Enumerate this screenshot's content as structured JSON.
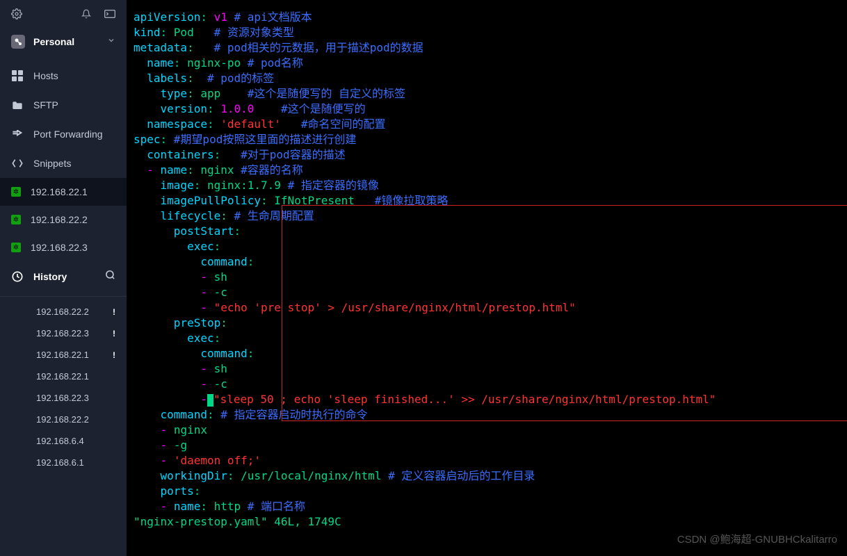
{
  "account": {
    "label": "Personal"
  },
  "nav": {
    "hosts": "Hosts",
    "sftp": "SFTP",
    "port_forwarding": "Port Forwarding",
    "snippets": "Snippets"
  },
  "servers": [
    {
      "ip": "192.168.22.1",
      "active": true
    },
    {
      "ip": "192.168.22.2",
      "active": false
    },
    {
      "ip": "192.168.22.3",
      "active": false
    }
  ],
  "history_label": "History",
  "history": [
    {
      "ip": "192.168.22.2",
      "alert": true
    },
    {
      "ip": "192.168.22.3",
      "alert": true
    },
    {
      "ip": "192.168.22.1",
      "alert": true
    },
    {
      "ip": "192.168.22.1",
      "alert": false
    },
    {
      "ip": "192.168.22.3",
      "alert": false
    },
    {
      "ip": "192.168.22.2",
      "alert": false
    },
    {
      "ip": "192.168.6.4",
      "alert": false
    },
    {
      "ip": "192.168.6.1",
      "alert": false
    }
  ],
  "code": {
    "l1_k": "apiVersion",
    "l1_v": "v1",
    "l1_c": "# api文档版本",
    "l2_k": "kind",
    "l2_v": "Pod",
    "l2_c": "# 资源对象类型",
    "l3_k": "metadata",
    "l3_c": "# pod相关的元数据，用于描述pod的数据",
    "l4_k": "name",
    "l4_v": "nginx-po",
    "l4_c": "# pod名称",
    "l5_k": "labels",
    "l5_c": "# pod的标签",
    "l6_k": "type",
    "l6_v": "app",
    "l6_c": "#这个是随便写的 自定义的标签",
    "l7_k": "version",
    "l7_v": "1.0.0",
    "l7_c": "#这个是随便写的",
    "l8_k": "namespace",
    "l8_v": "'default'",
    "l8_c": "#命名空间的配置",
    "l9_k": "spec",
    "l9_c": "#期望pod按照这里面的描述进行创建",
    "l10_k": "containers",
    "l10_c": "#对于pod容器的描述",
    "l11_d": "-",
    "l11_k": "name",
    "l11_v": "nginx",
    "l11_c": "#容器的名称",
    "l12_k": "image",
    "l12_v": "nginx:1.7.9",
    "l12_c": "# 指定容器的镜像",
    "l13_k": "imagePullPolicy",
    "l13_v": "IfNotPresent",
    "l13_c": "#镜像拉取策略",
    "l14_k": "lifecycle",
    "l14_c": "# 生命周期配置",
    "l15_k": "postStart",
    "l16_k": "exec",
    "l17_k": "command",
    "l18_d": "-",
    "l18_v": "sh",
    "l19_d": "-",
    "l19_v": "-c",
    "l20_d": "-",
    "l20_v": "\"echo 'pre stop' > /usr/share/nginx/html/prestop.html\"",
    "l21_k": "preStop",
    "l22_k": "exec",
    "l23_k": "command",
    "l24_d": "-",
    "l24_v": "sh",
    "l25_d": "-",
    "l25_v": "-c",
    "l26_d": "-",
    "l26_v": "\"sleep 50 ; echo 'sleep finished...' >> /usr/share/nginx/html/prestop.html\"",
    "l27_k": "command",
    "l27_c": "# 指定容器启动时执行的命令",
    "l28_d": "-",
    "l28_v": "nginx",
    "l29_d": "-",
    "l29_v": "-g",
    "l30_d": "-",
    "l30_v": "'daemon off;'",
    "l31_k": "workingDir",
    "l31_v": "/usr/local/nginx/html",
    "l31_c": "# 定义容器启动后的工作目录",
    "l32_k": "ports",
    "l33_d": "-",
    "l33_k": "name",
    "l33_v": "http",
    "l33_c": "# 端口名称"
  },
  "status_line": "\"nginx-prestop.yaml\" 46L, 1749C",
  "watermark": "CSDN @鲍海超-GNUBHCkalitarro"
}
